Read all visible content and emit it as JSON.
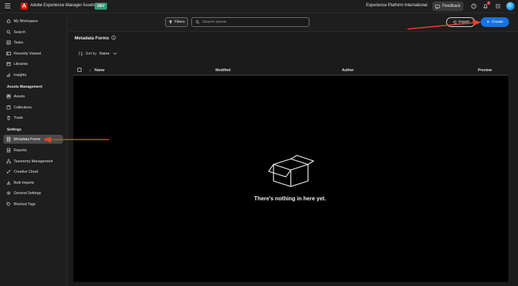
{
  "topbar": {
    "app_name": "Adobe Experience Manager Assets",
    "env_badge": "DEV",
    "org_name": "Experience Platform International",
    "feedback_label": "Feedback",
    "notification_count": "1"
  },
  "sidebar": {
    "items_top": [
      {
        "label": "My Workspace",
        "icon": "home-icon"
      },
      {
        "label": "Search",
        "icon": "search-icon"
      },
      {
        "label": "Tasks",
        "icon": "tasks-icon"
      },
      {
        "label": "Recently Viewed",
        "icon": "recent-icon"
      },
      {
        "label": "Libraries",
        "icon": "library-icon"
      },
      {
        "label": "Insights",
        "icon": "chart-icon"
      }
    ],
    "section_assets_management": "Assets Management",
    "items_assets": [
      {
        "label": "Assets",
        "icon": "assets-icon"
      },
      {
        "label": "Collections",
        "icon": "collection-icon"
      },
      {
        "label": "Trash",
        "icon": "trash-icon"
      }
    ],
    "section_settings": "Settings",
    "items_settings": [
      {
        "label": "Metadata Forms",
        "icon": "form-icon",
        "active": true
      },
      {
        "label": "Reports",
        "icon": "report-icon"
      },
      {
        "label": "Taxonomy Management",
        "icon": "taxonomy-icon"
      },
      {
        "label": "Creative Cloud",
        "icon": "creative-cloud-icon"
      },
      {
        "label": "Bulk Imports",
        "icon": "import-icon"
      },
      {
        "label": "General Settings",
        "icon": "gear-icon"
      },
      {
        "label": "Blocked Tags",
        "icon": "tag-icon"
      }
    ]
  },
  "toolbar": {
    "filters_label": "Filters",
    "search_placeholder": "Search assets",
    "import_label": "Import",
    "create_label": "Create"
  },
  "main": {
    "title": "Metadata Forms",
    "sort_by_label": "Sort by",
    "sort_value": "Name",
    "columns": [
      "Name",
      "Modified",
      "Author",
      "Preview"
    ],
    "empty_message": "There's nothing in here yet."
  },
  "colors": {
    "accent": "#1473e6",
    "env_badge": "#2d9d78",
    "annotation_arrow": "#e8412c"
  }
}
